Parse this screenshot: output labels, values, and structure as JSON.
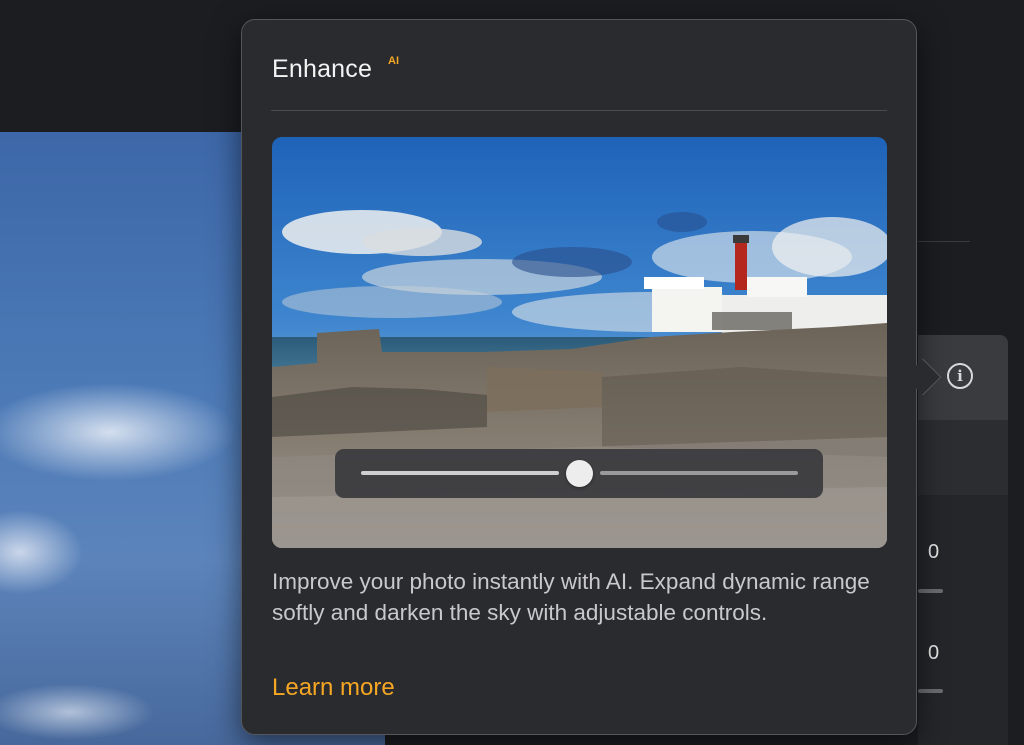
{
  "popover": {
    "title": "Enhance",
    "badge": "AI",
    "description": "Improve your photo instantly with AI. Expand dynamic range softly and darken the sky with adjustable controls.",
    "learn_more": "Learn more",
    "slider_level": 0.5,
    "accent_color": "#f5a623"
  },
  "side_panel": {
    "info_icon": "info-circle-icon",
    "values": [
      "0",
      "0"
    ]
  }
}
